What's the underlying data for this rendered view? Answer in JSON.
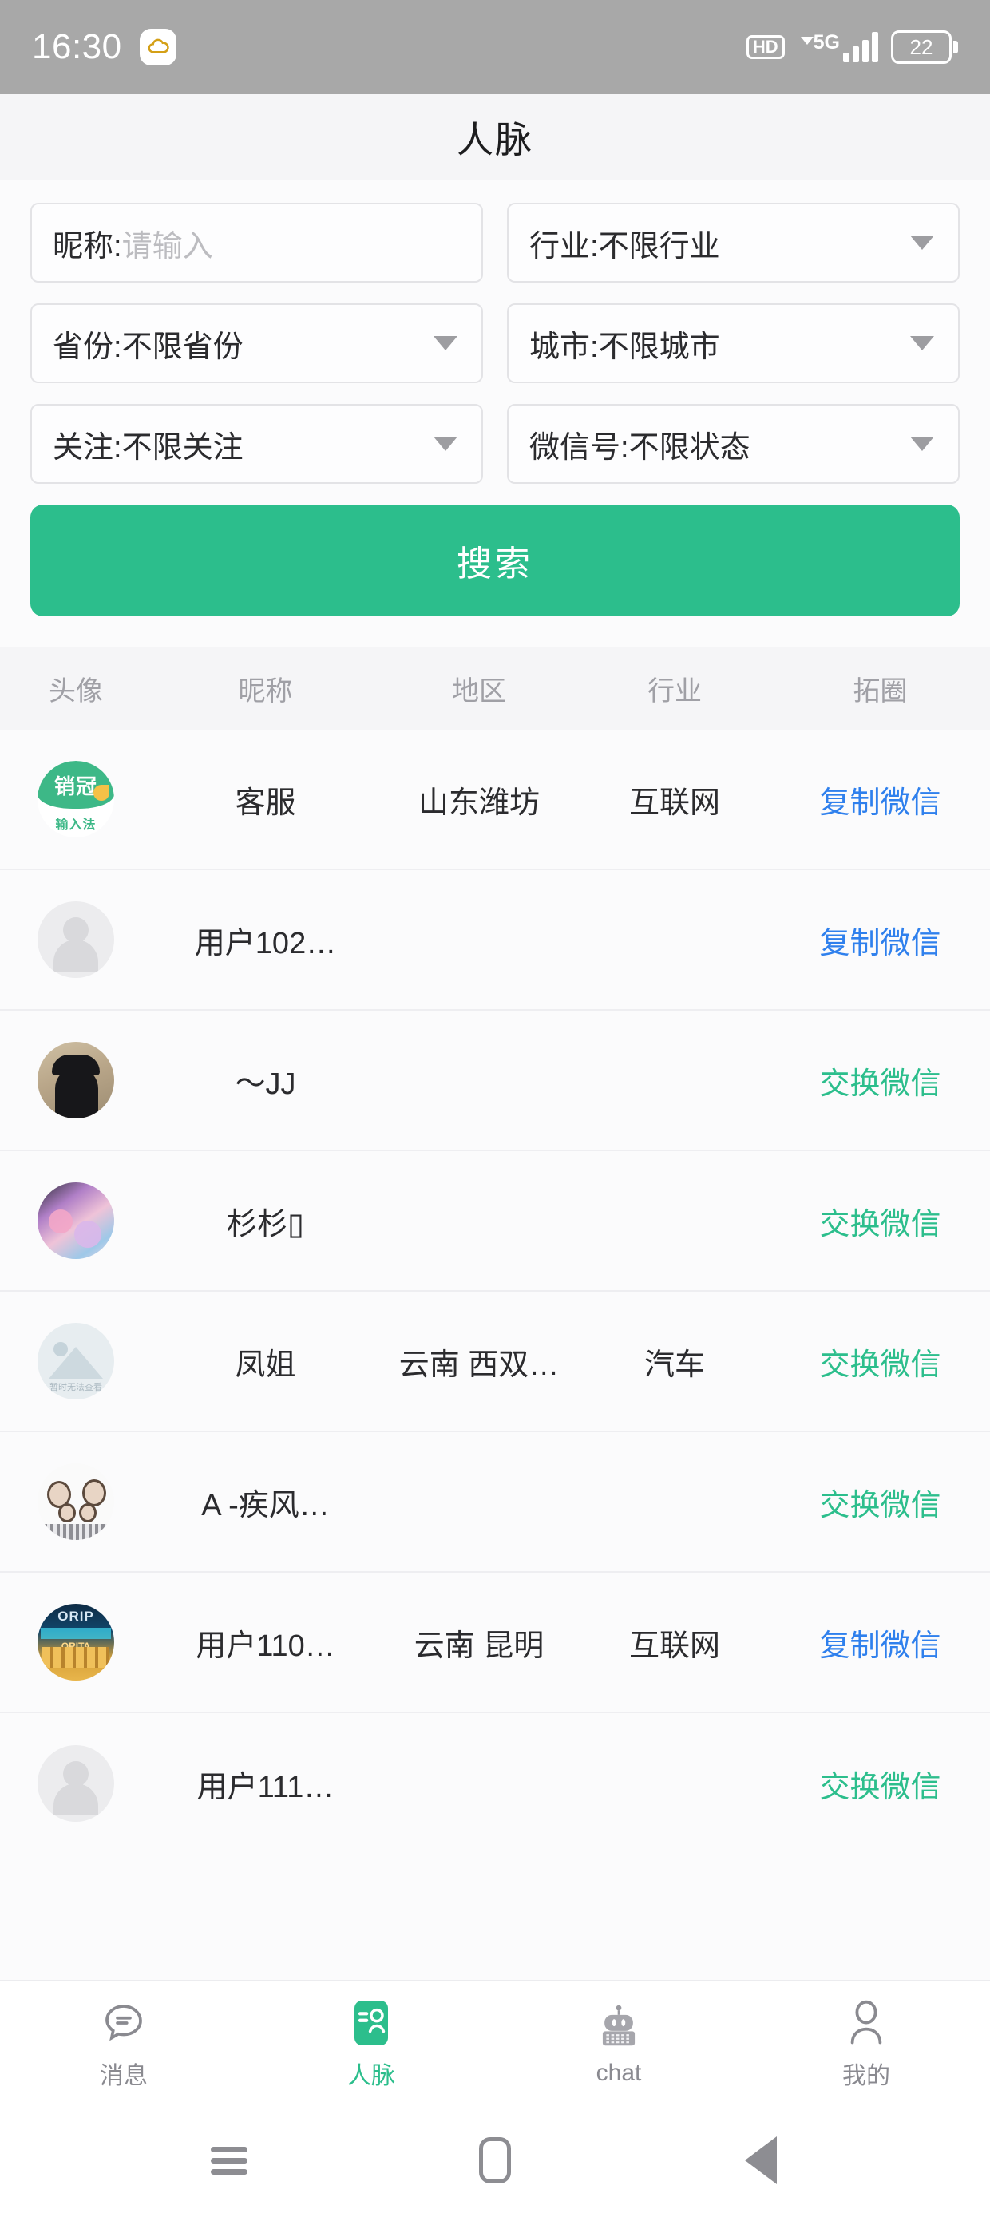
{
  "status_bar": {
    "time": "16:30",
    "app_icon": "cloud-sync-icon",
    "hd_label": "HD",
    "network_label": "5G",
    "battery_level": "22"
  },
  "header": {
    "title": "人脉"
  },
  "filters": {
    "nickname": {
      "label": "昵称:",
      "value": "",
      "placeholder": "请输入"
    },
    "industry": {
      "label": "行业:",
      "value": "不限行业"
    },
    "province": {
      "label": "省份:",
      "value": "不限省份"
    },
    "city": {
      "label": "城市:",
      "value": "不限城市"
    },
    "follow": {
      "label": "关注:",
      "value": "不限关注"
    },
    "wechat": {
      "label": "微信号:",
      "value": "不限状态"
    },
    "search_button": "搜索"
  },
  "table": {
    "columns": [
      "头像",
      "昵称",
      "地区",
      "行业",
      "拓圈"
    ],
    "rows": [
      {
        "avatar": "brand-logo-avatar",
        "avatar_text_top": "销冠",
        "avatar_text_bottom": "输入法",
        "nickname": "客服",
        "region": "山东潍坊",
        "industry": "互联网",
        "action": "复制微信",
        "action_type": "copy"
      },
      {
        "avatar": "default-person-avatar",
        "avatar_text_top": "",
        "avatar_text_bottom": "",
        "nickname": "用户102…",
        "region": "",
        "industry": "",
        "action": "复制微信",
        "action_type": "copy"
      },
      {
        "avatar": "photo-silhouette-avatar",
        "avatar_text_top": "",
        "avatar_text_bottom": "",
        "nickname": "～JJ",
        "region": "",
        "industry": "",
        "action": "交换微信",
        "action_type": "exchange"
      },
      {
        "avatar": "photo-flowers-avatar",
        "avatar_text_top": "",
        "avatar_text_bottom": "",
        "nickname": "杉杉▯",
        "region": "",
        "industry": "",
        "action": "交换微信",
        "action_type": "exchange"
      },
      {
        "avatar": "image-unavailable-avatar",
        "avatar_text_top": "",
        "avatar_text_bottom": "暂时无法查看",
        "nickname": "凤姐",
        "region": "云南 西双…",
        "industry": "汽车",
        "action": "交换微信",
        "action_type": "exchange"
      },
      {
        "avatar": "cartoon-family-avatar",
        "avatar_text_top": "",
        "avatar_text_bottom": "",
        "nickname": "A -疾风…",
        "region": "",
        "industry": "",
        "action": "交换微信",
        "action_type": "exchange"
      },
      {
        "avatar": "neon-storefront-avatar",
        "avatar_text_top": "ORIP",
        "avatar_text_bottom": "ORITA",
        "nickname": "用户110…",
        "region": "云南 昆明",
        "industry": "互联网",
        "action": "复制微信",
        "action_type": "copy"
      },
      {
        "avatar": "default-person-avatar",
        "avatar_text_top": "",
        "avatar_text_bottom": "",
        "nickname": "用户111…",
        "region": "",
        "industry": "",
        "action": "交换微信",
        "action_type": "exchange"
      }
    ]
  },
  "tabbar": {
    "items": [
      {
        "icon": "message-bubble-icon",
        "label": "消息",
        "active": false
      },
      {
        "icon": "contacts-card-icon",
        "label": "人脉",
        "active": true
      },
      {
        "icon": "robot-icon",
        "label": "chat",
        "active": false
      },
      {
        "icon": "person-icon",
        "label": "我的",
        "active": false
      }
    ]
  },
  "system_nav": {
    "menu": "menu-icon",
    "home": "home-icon",
    "back": "back-icon"
  },
  "colors": {
    "accent_green": "#2cbe8c",
    "link_blue": "#2f80ed",
    "status_bar_bg": "#a8a8a8",
    "header_bg": "#f5f5f7"
  }
}
